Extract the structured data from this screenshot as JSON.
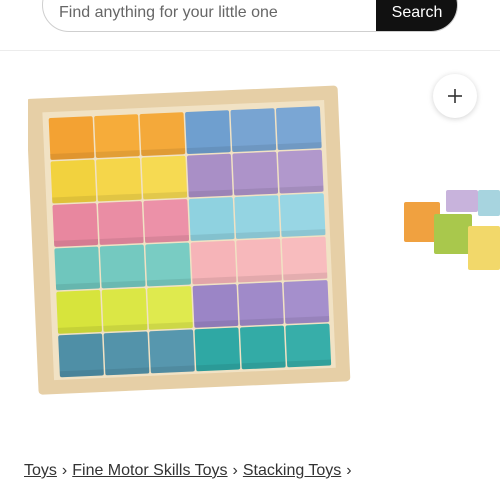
{
  "search": {
    "placeholder": "Find anything for your little one",
    "button_label": "Search"
  },
  "product": {
    "image_alt": "Rainbow wooden stacking blocks in wooden tray",
    "add_icon": "plus-icon",
    "block_colors": [
      [
        "#f3a233",
        "#f6ac3a",
        "#f4a93a",
        "#6f9fcf",
        "#78a4d2",
        "#7aa6d4"
      ],
      [
        "#f2d23e",
        "#f5d64a",
        "#f6da52",
        "#a98fc6",
        "#ad93c9",
        "#b198cc"
      ],
      [
        "#e8879f",
        "#ea8da4",
        "#ec91a8",
        "#8fd2e0",
        "#94d4e2",
        "#98d6e4"
      ],
      [
        "#6fc6bd",
        "#74c9c0",
        "#79ccc3",
        "#f6b4b8",
        "#f7b8bb",
        "#f8bcbe"
      ],
      [
        "#d7e43c",
        "#dbe745",
        "#dfea4e",
        "#9b85c6",
        "#a08ac9",
        "#a58fcc"
      ],
      [
        "#4f8fa6",
        "#5393aa",
        "#5797ae",
        "#2fa8a4",
        "#33aba6",
        "#37aea9"
      ]
    ],
    "side_blocks": [
      "#f0a140",
      "#a9c84c",
      "#f2d86a",
      "#c8b3dc",
      "#a7d4df"
    ]
  },
  "breadcrumb": {
    "items": [
      "Toys",
      "Fine Motor Skills Toys",
      "Stacking Toys"
    ],
    "separator": "›"
  }
}
